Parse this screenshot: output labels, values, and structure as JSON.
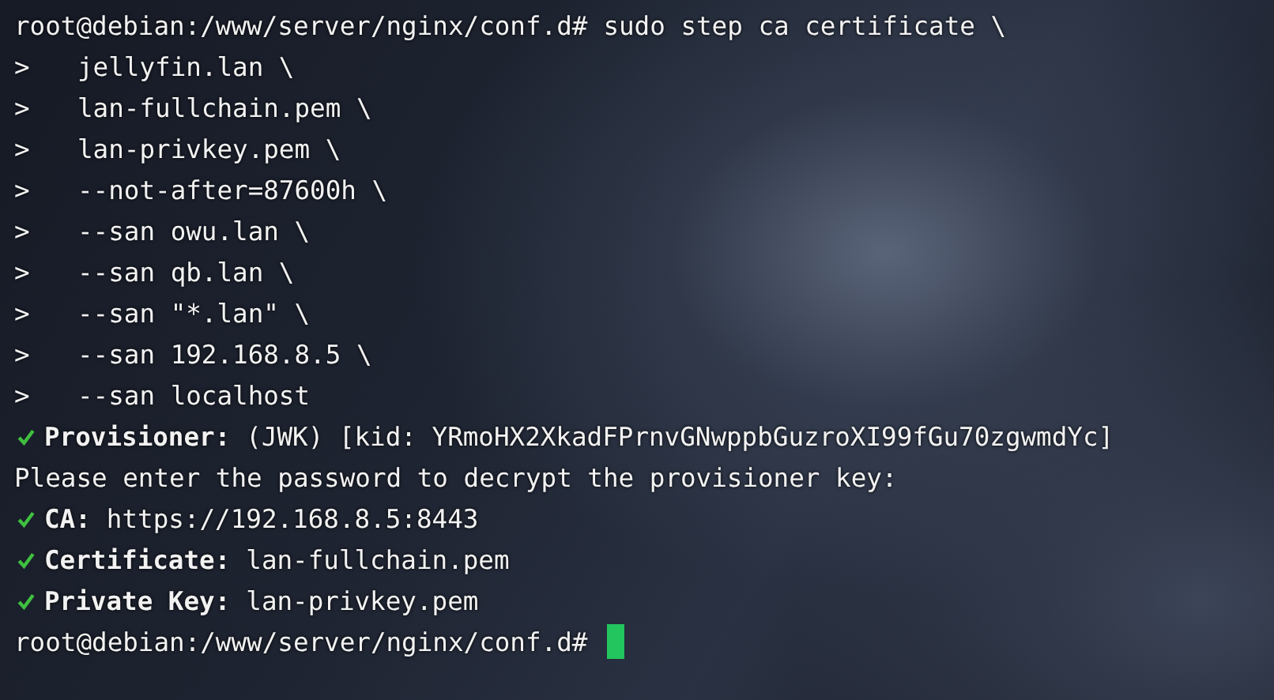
{
  "terminal": {
    "lines": [
      {
        "kind": "command",
        "prompt": "root@debian:/www/server/nginx/conf.d#",
        "text": "sudo step ca certificate \\"
      },
      {
        "kind": "continuation",
        "marker": ">",
        "text": "jellyfin.lan \\"
      },
      {
        "kind": "continuation",
        "marker": ">",
        "text": "lan-fullchain.pem \\"
      },
      {
        "kind": "continuation",
        "marker": ">",
        "text": "lan-privkey.pem \\"
      },
      {
        "kind": "continuation",
        "marker": ">",
        "text": "--not-after=87600h \\"
      },
      {
        "kind": "continuation",
        "marker": ">",
        "text": "--san owu.lan \\"
      },
      {
        "kind": "continuation",
        "marker": ">",
        "text": "--san qb.lan \\"
      },
      {
        "kind": "continuation",
        "marker": ">",
        "text": "--san \"*.lan\" \\"
      },
      {
        "kind": "continuation",
        "marker": ">",
        "text": "--san 192.168.8.5 \\"
      },
      {
        "kind": "continuation",
        "marker": ">",
        "text": "--san localhost"
      },
      {
        "kind": "status",
        "label": "Provisioner:",
        "text": "(JWK) [kid: YRmoHX2XkadFPrnvGNwppbGuzroXI99fGu70zgwmdYc]"
      },
      {
        "kind": "plain",
        "text": "Please enter the password to decrypt the provisioner key:"
      },
      {
        "kind": "status",
        "label": "CA:",
        "text": "https://192.168.8.5:8443"
      },
      {
        "kind": "status",
        "label": "Certificate:",
        "text": "lan-fullchain.pem"
      },
      {
        "kind": "status",
        "label": "Private Key:",
        "text": "lan-privkey.pem"
      },
      {
        "kind": "input",
        "prompt": "root@debian:/www/server/nginx/conf.d#"
      }
    ]
  }
}
